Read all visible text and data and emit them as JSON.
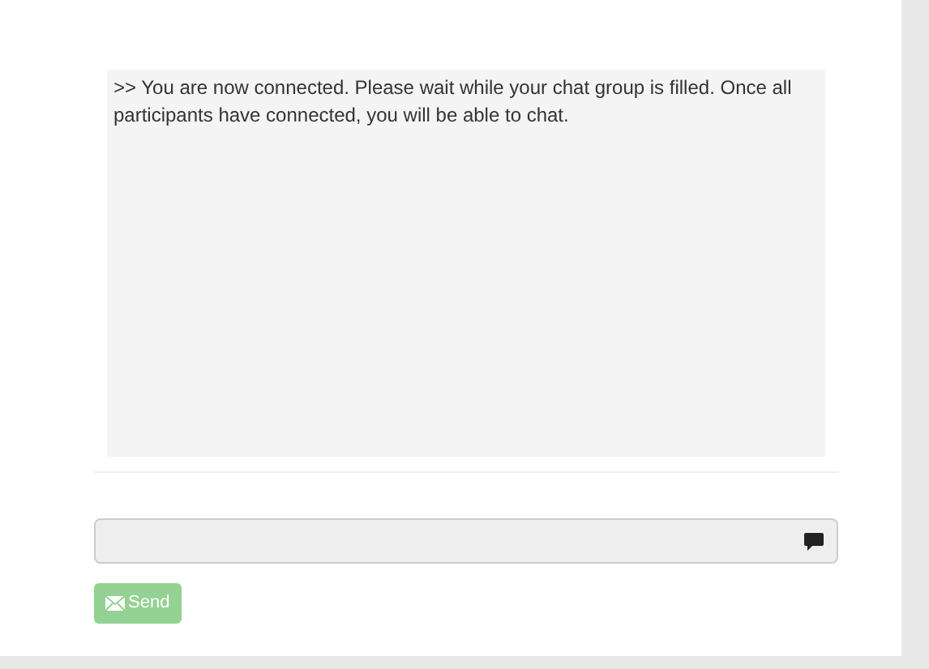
{
  "chat_log": {
    "messages": [
      ">> You are now connected. Please wait while your chat group is filled. Once all participants have connected, you will be able to chat."
    ]
  },
  "message_input": {
    "disabled": true
  },
  "send_button": {
    "label": "Send",
    "disabled": true
  }
}
